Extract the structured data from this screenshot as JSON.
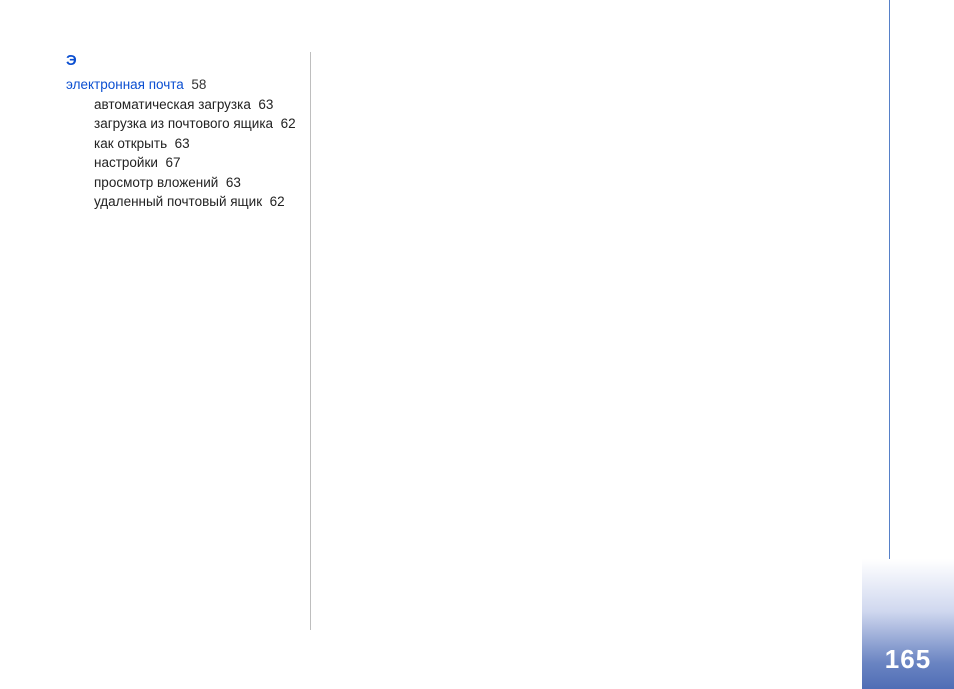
{
  "page_number": "165",
  "section": {
    "letter": "Э",
    "heading": {
      "label": "электронная почта",
      "page": "58"
    },
    "subentries": [
      {
        "label": "автоматическая загрузка",
        "page": "63"
      },
      {
        "label": "загрузка из почтового ящика",
        "page": "62"
      },
      {
        "label": "как открыть",
        "page": "63"
      },
      {
        "label": "настройки",
        "page": "67"
      },
      {
        "label": "просмотр вложений",
        "page": "63"
      },
      {
        "label": "удаленный почтовый ящик",
        "page": "62"
      }
    ]
  }
}
